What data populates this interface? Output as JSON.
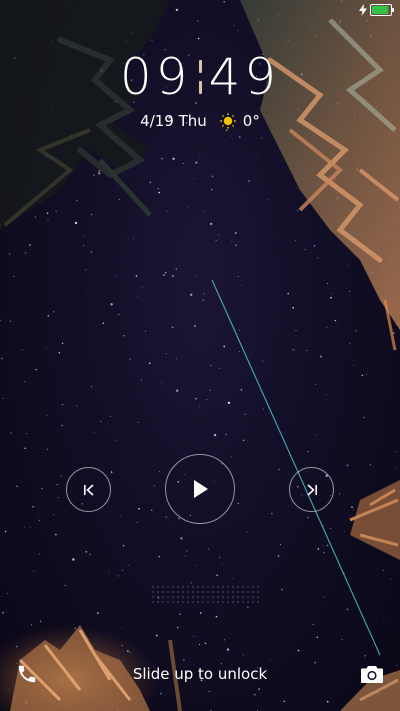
{
  "status_bar": {
    "battery_level": 0.9,
    "battery_color": "#36c24a",
    "charging": true,
    "charge_icon": "lightning-icon",
    "battery_icon": "battery-icon"
  },
  "clock": {
    "hours": "09",
    "minutes": "49",
    "separator_color": "#d8c6a8"
  },
  "date_weather": {
    "date": "4/19 Thu",
    "weather_icon": "sun-icon",
    "weather_icon_color": "#f5c400",
    "temperature": "0°"
  },
  "media": {
    "prev_icon": "skip-previous-icon",
    "play_icon": "play-icon",
    "next_icon": "skip-next-icon"
  },
  "bottom": {
    "phone_icon": "phone-icon",
    "unlock_text": "Slide up to unlock",
    "camera_icon": "camera-icon"
  }
}
